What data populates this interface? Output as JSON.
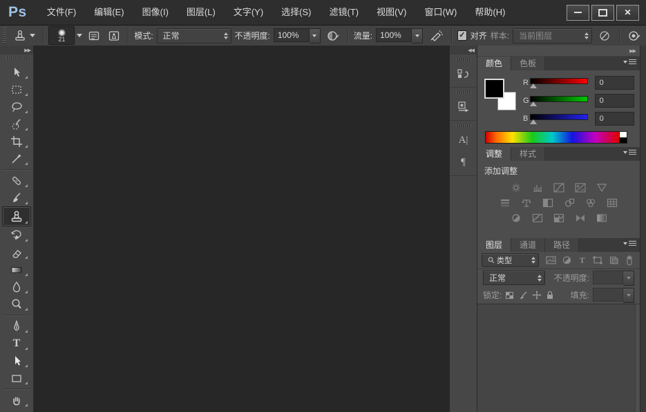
{
  "window": {
    "logo": "Ps",
    "brand_color": "#9cc3e6",
    "controls": {
      "close_glyph": "✕"
    }
  },
  "menu": {
    "items": [
      "文件(F)",
      "编辑(E)",
      "图像(I)",
      "图层(L)",
      "文字(Y)",
      "选择(S)",
      "滤镜(T)",
      "视图(V)",
      "窗口(W)",
      "帮助(H)"
    ]
  },
  "options_bar": {
    "tool_preset_size": "21",
    "mode_label": "模式:",
    "mode_value": "正常",
    "opacity_label": "不透明度:",
    "opacity_value": "100%",
    "flow_label": "流量:",
    "flow_value": "100%",
    "align_glyph": "✓",
    "align_label": "对齐",
    "sample_label": "样本:",
    "sample_value": "当前图层"
  },
  "toolbar": {
    "expand_glyph": "▶▶",
    "selected_tool": "clone-stamp",
    "type_tool_glyph": "T",
    "tools": [
      "move",
      "rectangular-marquee",
      "lasso",
      "quick-selection",
      "crop",
      "eyedropper",
      "spot-healing-brush",
      "brush",
      "clone-stamp",
      "history-brush",
      "eraser",
      "gradient",
      "blur",
      "dodge",
      "pen",
      "type",
      "path-selection",
      "rectangle",
      "hand"
    ]
  },
  "dock_strip": {
    "collapse_glyph": "◀◀",
    "icons": [
      "history",
      "properties",
      "character",
      "paragraph"
    ],
    "character_glyph": "A|",
    "paragraph_glyph": "¶"
  },
  "panel_dock": {
    "collapse_glyph": "▶▶",
    "color_panel": {
      "tabs": [
        "颜色",
        "色板"
      ],
      "active_tab": "颜色",
      "foreground_color": "#000000",
      "background_color": "#ffffff",
      "channels": [
        {
          "label": "R",
          "value": "0",
          "gradient_to": "#ff0000"
        },
        {
          "label": "G",
          "value": "0",
          "gradient_to": "#00ff00"
        },
        {
          "label": "B",
          "value": "0",
          "gradient_to": "#0000ff"
        }
      ]
    },
    "adjustments_panel": {
      "tabs": [
        "调整",
        "样式"
      ],
      "active_tab": "调整",
      "title": "添加调整",
      "icon_rows": [
        [
          "brightness-contrast",
          "levels",
          "curves",
          "exposure",
          "vibrance"
        ],
        [
          "hue-saturation",
          "color-balance",
          "black-white",
          "photo-filter",
          "channel-mixer",
          "color-lookup"
        ],
        [
          "invert",
          "posterize",
          "threshold",
          "gradient-map",
          "selective-color"
        ]
      ]
    },
    "layers_panel": {
      "tabs": [
        "图层",
        "通道",
        "路径"
      ],
      "active_tab": "图层",
      "filter_value": "类型",
      "type_filter_glyph": "T",
      "blend_mode": "正常",
      "opacity_label": "不透明度:",
      "lock_label": "锁定:",
      "fill_label": "填充:",
      "lock_icons": [
        "lock-transparent-pixels",
        "lock-image-pixels",
        "lock-position",
        "lock-all"
      ]
    }
  }
}
